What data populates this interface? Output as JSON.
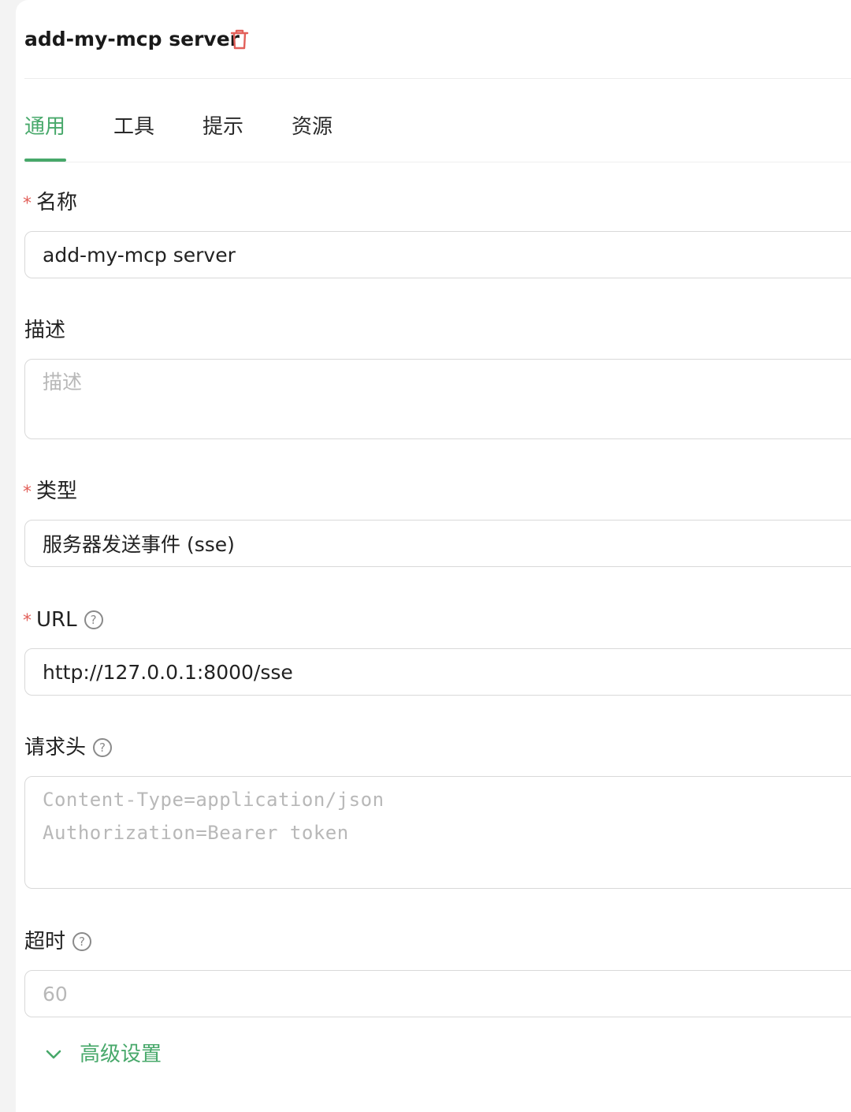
{
  "header": {
    "title": "add-my-mcp server",
    "delete_icon": "trash-icon"
  },
  "tabs": [
    {
      "label": "通用",
      "active": true
    },
    {
      "label": "工具",
      "active": false
    },
    {
      "label": "提示",
      "active": false
    },
    {
      "label": "资源",
      "active": false
    }
  ],
  "form": {
    "name": {
      "label": "名称",
      "required_mark": "*",
      "value": "add-my-mcp server"
    },
    "description": {
      "label": "描述",
      "placeholder": "描述",
      "value": ""
    },
    "type": {
      "label": "类型",
      "required_mark": "*",
      "value": "服务器发送事件 (sse)"
    },
    "url": {
      "label": "URL",
      "required_mark": "*",
      "help": "?",
      "value": "http://127.0.0.1:8000/sse"
    },
    "headers": {
      "label": "请求头",
      "help": "?",
      "placeholder": "Content-Type=application/json\nAuthorization=Bearer token",
      "value": ""
    },
    "timeout": {
      "label": "超时",
      "help": "?",
      "placeholder": "60",
      "value": ""
    }
  },
  "advanced": {
    "label": "高级设置",
    "icon": "chevron-down-icon"
  },
  "colors": {
    "accent": "#47a86a",
    "danger": "#e2605a",
    "border": "#d9d9d9"
  }
}
